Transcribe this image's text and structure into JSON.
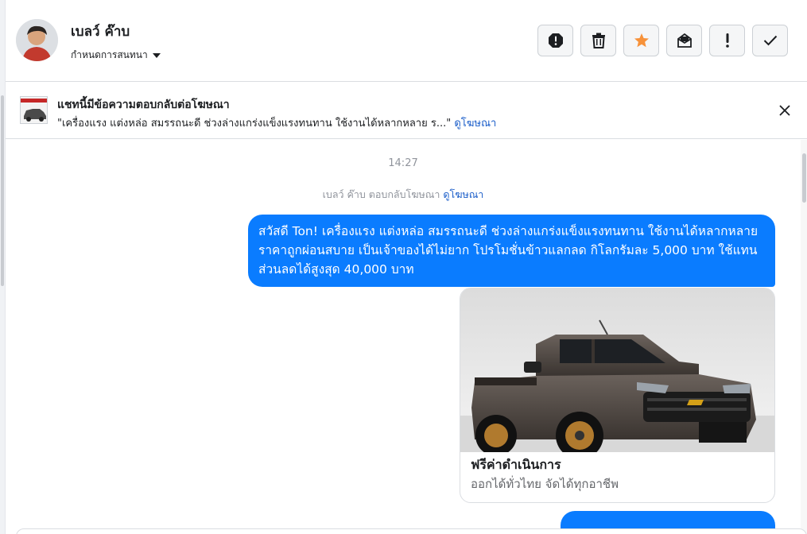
{
  "header": {
    "contact_name": "เบลว์ ค๊าบ",
    "conversation_setting": "กำหนดการสนทนา",
    "actions": [
      {
        "name": "report-spam",
        "icon": "alert-circle-icon"
      },
      {
        "name": "delete",
        "icon": "trash-icon"
      },
      {
        "name": "star",
        "icon": "star-icon"
      },
      {
        "name": "mark-unread",
        "icon": "envelope-icon"
      },
      {
        "name": "important",
        "icon": "exclamation-icon"
      },
      {
        "name": "done",
        "icon": "checkmark-icon"
      }
    ]
  },
  "ad_banner": {
    "title": "แชทนี้มีข้อความตอบกลับต่อโฆษณา",
    "description": "\"เครื่องแรง แต่งหล่อ สมรรถนะดี ช่วงล่างแกร่งแข็งแรงทนทาน ใช้งานได้หลากหลาย ร...\"",
    "link": "ดูโฆษณา"
  },
  "chat": {
    "timestamp": "14:27",
    "reply_note": "เบลว์ ค๊าบ ตอบกลับโฆษณา",
    "reply_note_link": "ดูโฆษณา",
    "message_text": "สวัสดี Ton! เครื่องแรง แต่งหล่อ สมรรถนะดี ช่วงล่างแกร่งแข็งแรงทนทาน ใช้งานได้หลากหลาย ราคาถูกผ่อนสบาย เป็นเจ้าของได้ไม่ยาก โปรโมชั่นข้าวแลกลด กิโลกรัมละ 5,000 บาท ใช้แทนส่วนลดได้สูงสุด 40,000 บาท",
    "card": {
      "title": "ฟรีค่าดำเนินการ",
      "subtitle": "ออกได้ทั่วไทย จัดได้ทุกอาชีพ"
    }
  },
  "colors": {
    "bubble": "#0a7cff",
    "star": "#f7923a",
    "link": "#1a5dc9"
  }
}
